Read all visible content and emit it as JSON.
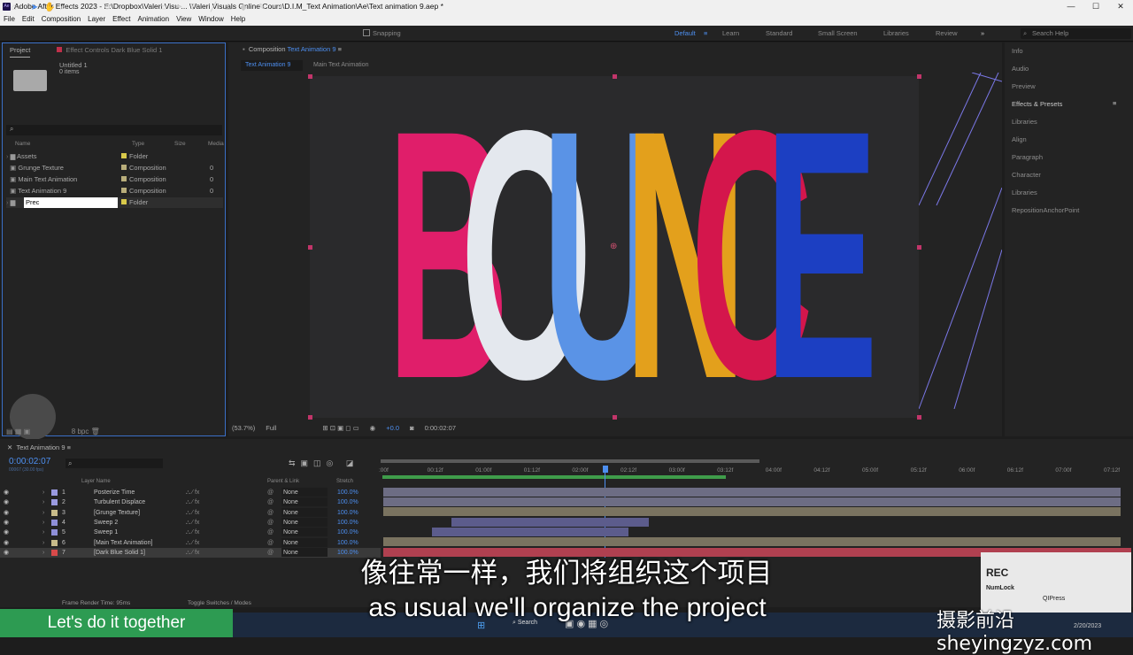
{
  "window": {
    "title": "Adobe After Effects 2023 - E:\\Dropbox\\Valeri Visu ... \\Valeri Visuals Online Cours\\D.I.M_Text Animation\\Ae\\Text animation 9.aep *",
    "icon_text": "Ae"
  },
  "menu": [
    "File",
    "Edit",
    "Composition",
    "Layer",
    "Effect",
    "Animation",
    "View",
    "Window",
    "Help"
  ],
  "toolbar": {
    "snapping": "Snapping"
  },
  "workspaces": [
    "Default",
    "Learn",
    "Standard",
    "Small Screen",
    "Libraries",
    "Review"
  ],
  "search_help": "Search Help",
  "project": {
    "tab": "Project",
    "effect_controls": "Effect Controls Dark Blue Solid 1",
    "comp_name": "Untitled 1",
    "items": "0 items",
    "columns": {
      "name": "Name",
      "type": "Type",
      "size": "Size",
      "media": "Media"
    },
    "rows": [
      {
        "name": "Assets",
        "type": "Folder",
        "color": "#d8c94a"
      },
      {
        "name": "Grunge Texture",
        "type": "Composition",
        "color": "#b8ad7a",
        "size": "0"
      },
      {
        "name": "Main Text Animation",
        "type": "Composition",
        "color": "#b8ad7a",
        "size": "0"
      },
      {
        "name": "Text Animation 9",
        "type": "Composition",
        "color": "#b8ad7a",
        "size": "0"
      },
      {
        "name": "Prec",
        "type": "Folder",
        "color": "#d8c94a"
      }
    ],
    "bpc": "8 bpc"
  },
  "composition": {
    "tab_label": "Composition",
    "tab_name": "Text Animation 9",
    "breadcrumbs": [
      "Text Animation 9",
      "Main Text Animation"
    ],
    "zoom": "(53.7%)",
    "resolution": "Full",
    "exposure": "+0.0",
    "timecode": "0:00:02:07",
    "letters": [
      {
        "char": "B",
        "color": "#e01e6a"
      },
      {
        "char": "O",
        "color": "#e4e8ee"
      },
      {
        "char": "U",
        "color": "#5a93e6"
      },
      {
        "char": "N",
        "color": "#e3a01c"
      },
      {
        "char": "C",
        "color": "#d4164c"
      },
      {
        "char": "E",
        "color": "#1c3fc2"
      }
    ]
  },
  "right_panel": [
    "Info",
    "Audio",
    "Preview",
    "Effects & Presets",
    "Libraries",
    "Align",
    "Paragraph",
    "Character",
    "Libraries",
    "RepositionAnchorPoint"
  ],
  "timeline": {
    "tab": "Text Animation 9",
    "current_time": "0:00:02:07",
    "fps": "00067 (30.00 fps)",
    "columns": {
      "layer_name": "Layer Name",
      "parent": "Parent & Link",
      "stretch": "Stretch"
    },
    "ruler": [
      ":00f",
      "00:12f",
      "01:00f",
      "01:12f",
      "02:00f",
      "02:12f",
      "03:00f",
      "03:12f",
      "04:00f",
      "04:12f",
      "05:00f",
      "05:12f",
      "06:00f",
      "06:12f",
      "07:00f",
      "07:12f"
    ],
    "layers": [
      {
        "num": "1",
        "name": "Posterize Time",
        "color": "#9a9ae0",
        "parent": "None",
        "stretch": "100.0%"
      },
      {
        "num": "2",
        "name": "Turbulent Displace",
        "color": "#9a9ae0",
        "parent": "None",
        "stretch": "100.0%"
      },
      {
        "num": "3",
        "name": "[Grunge Texture]",
        "color": "#c8bb8a",
        "parent": "None",
        "stretch": "100.0%"
      },
      {
        "num": "4",
        "name": "Sweep 2",
        "color": "#8f8fd8",
        "parent": "None",
        "stretch": "100.0%"
      },
      {
        "num": "5",
        "name": "Sweep 1",
        "color": "#8f8fd8",
        "parent": "None",
        "stretch": "100.0%"
      },
      {
        "num": "6",
        "name": "[Main Text Animation]",
        "color": "#c8bb8a",
        "parent": "None",
        "stretch": "100.0%"
      },
      {
        "num": "7",
        "name": "[Dark Blue Solid 1]",
        "color": "#d84a4a",
        "parent": "None",
        "stretch": "100.0%"
      }
    ],
    "frame_render": "Frame Render Time: 95ms",
    "toggle": "Toggle Switches / Modes"
  },
  "subtitles": {
    "cn": "像往常一样，我们将组织这个项目",
    "en": "as usual we'll organize the project"
  },
  "banner": "Let's do it together",
  "rec": {
    "title": "REC",
    "numlock": "NumLock",
    "app": "QIPress"
  },
  "watermark": "摄影前沿 sheyingzyz.com",
  "taskbar": {
    "search": "Search",
    "date": "2/20/2023"
  }
}
